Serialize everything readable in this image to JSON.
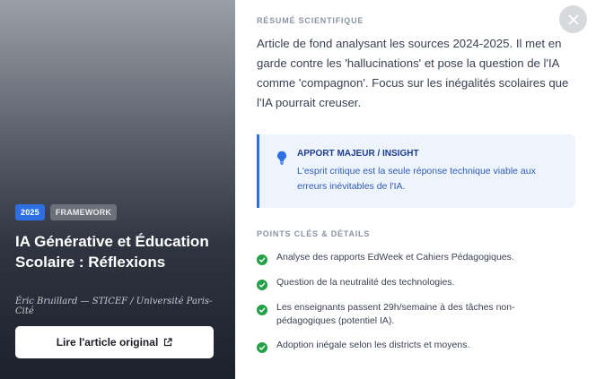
{
  "article": {
    "year_tag": "2025",
    "type_tag": "FRAMEWORK",
    "title": "IA Générative et Éducation Scolaire : Réflexions",
    "author": "Éric Bruillard — STICEF / Université Paris-Cité",
    "read_button_label": "Lire l'article original"
  },
  "summary": {
    "heading": "RÉSUMÉ SCIENTIFIQUE",
    "text": "Article de fond analysant les sources 2024-2025. Il met en garde contre les 'hallucinations' et pose la question de l'IA comme 'compagnon'. Focus sur les inégalités scolaires que l'IA pourrait creuser."
  },
  "insight": {
    "title": "APPORT MAJEUR / INSIGHT",
    "text": "L'esprit critique est la seule réponse technique viable aux erreurs inévitables de l'IA."
  },
  "key_points": {
    "heading": "POINTS CLÉS & DÉTAILS",
    "items": [
      "Analyse des rapports EdWeek et Cahiers Pédagogiques.",
      "Question de la neutralité des technologies.",
      "Les enseignants passent 29h/semaine à des tâches non-pédagogiques (potentiel IA).",
      "Adoption inégale selon les districts et moyens."
    ]
  },
  "icons": {
    "close": "close-icon",
    "external_link": "external-link-icon",
    "insight": "lightbulb-icon",
    "point": "check-circle-icon"
  },
  "colors": {
    "accent": "#2f6fe4",
    "check": "#24a148",
    "insight_bg": "#eef4fc"
  }
}
